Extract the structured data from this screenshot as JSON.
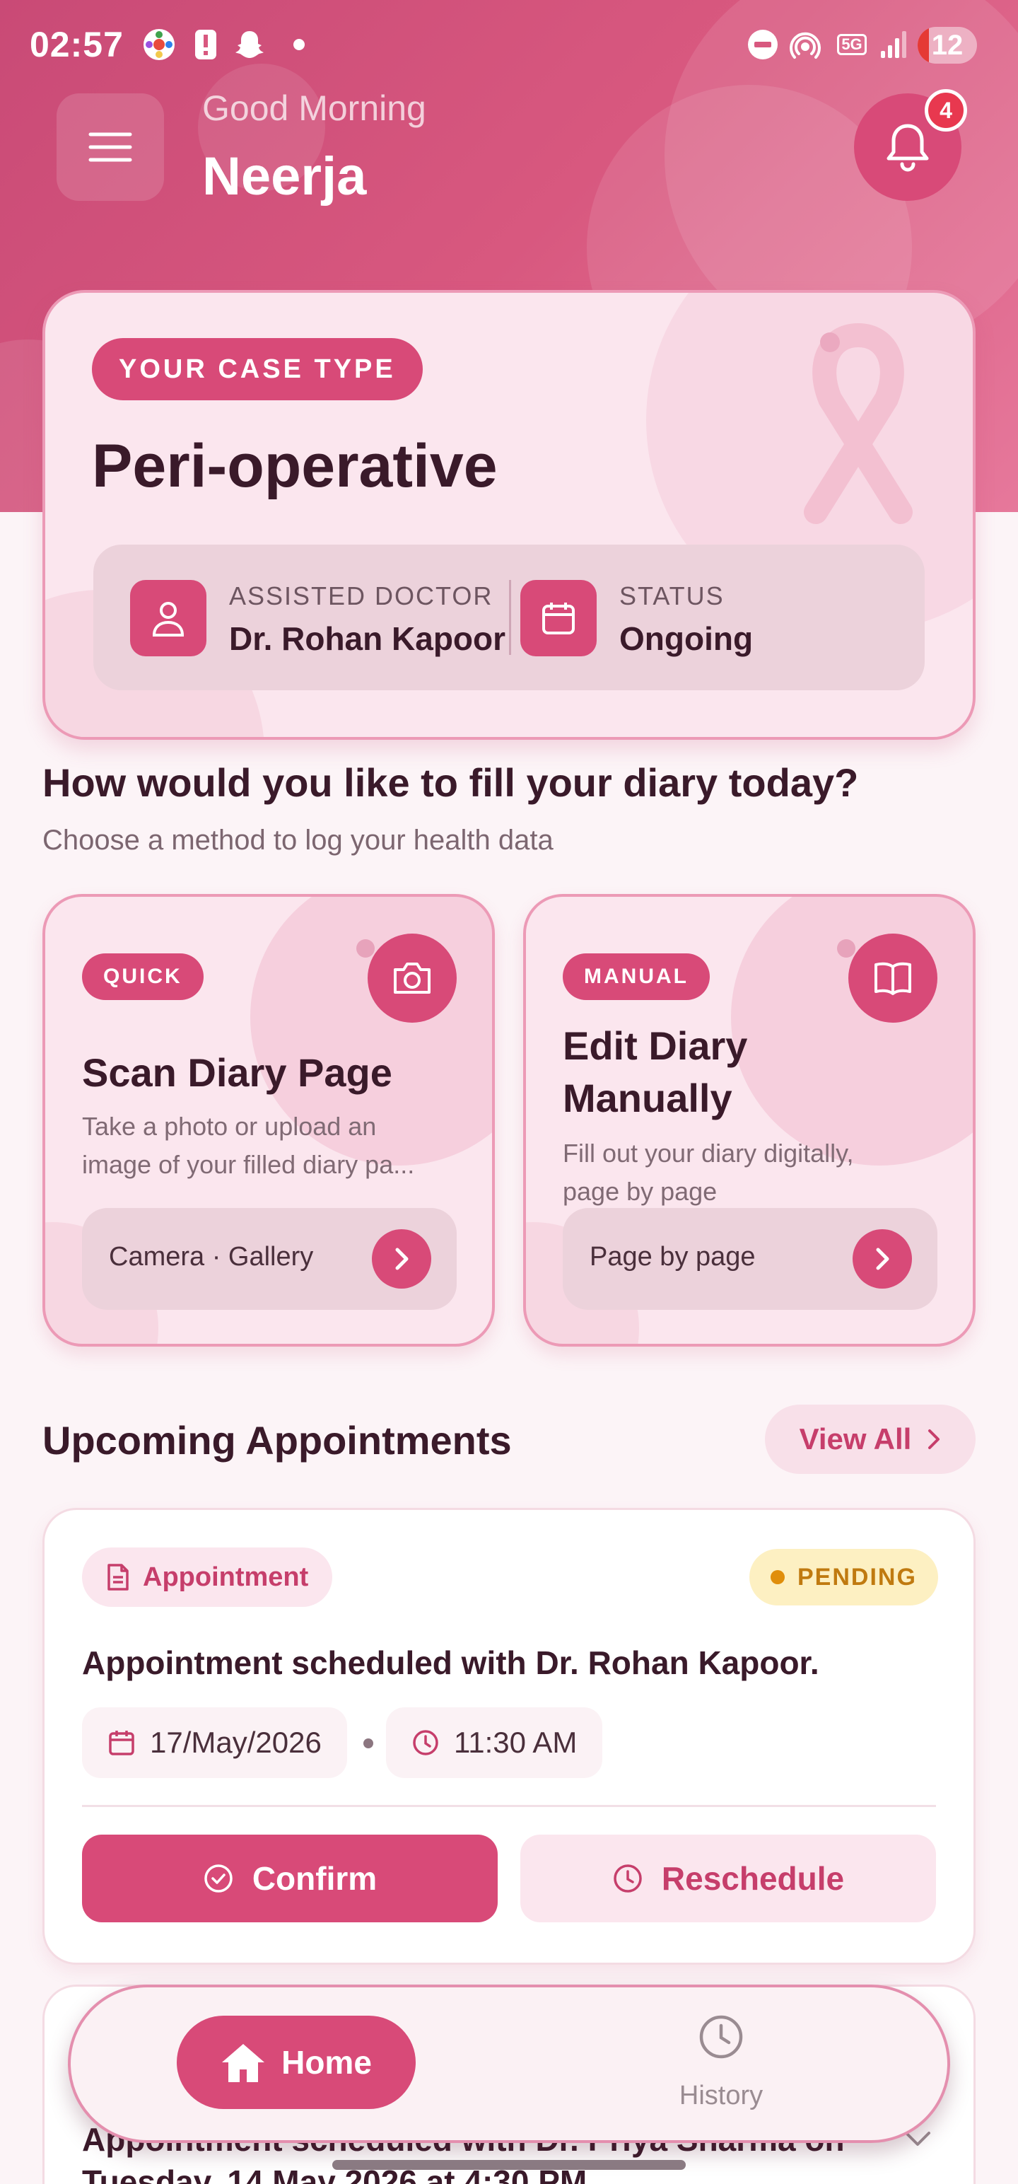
{
  "status_bar": {
    "time": "02:57",
    "network": "5G",
    "battery": "12"
  },
  "header": {
    "greeting": "Good Morning",
    "user_name": "Neerja",
    "notification_count": "4"
  },
  "case_card": {
    "label": "YOUR CASE TYPE",
    "case_type": "Peri-operative",
    "doctor_label": "ASSISTED DOCTOR",
    "doctor_name": "Dr. Rohan Kapoor",
    "status_label": "STATUS",
    "status_value": "Ongoing"
  },
  "diary": {
    "title": "How would you like to fill your diary today?",
    "subtitle": "Choose a method to log your health data",
    "methods": [
      {
        "tag": "QUICK",
        "title": "Scan Diary Page",
        "description_line1": "Take a photo or upload an",
        "description_line2": "image of your filled diary pa...",
        "action": "Camera · Gallery",
        "icon": "camera-icon"
      },
      {
        "tag": "MANUAL",
        "title_line1": "Edit Diary",
        "title_line2": "Manually",
        "description_line1": "Fill out your diary digitally,",
        "description_line2": "page by page",
        "action": "Page by page",
        "icon": "book-icon"
      }
    ]
  },
  "appointments": {
    "title": "Upcoming Appointments",
    "view_all": "View All",
    "items": [
      {
        "tag": "Appointment",
        "status": "PENDING",
        "text": "Appointment scheduled with Dr. Rohan Kapoor.",
        "date": "17/May/2026",
        "time": "11:30 AM",
        "confirm": "Confirm",
        "reschedule": "Reschedule"
      },
      {
        "text_line1": "Appointment scheduled with Dr. Priya Sharma on",
        "text_line2": "Tuesday, 14 May 2026 at 4:30 PM"
      }
    ]
  },
  "bottom_nav": {
    "home": "Home",
    "history": "History"
  },
  "colors": {
    "primary": "#d84a78",
    "header_gradient_start": "#c94a76",
    "header_gradient_end": "#e6789b",
    "card_bg": "#fbe6ee",
    "pending_bg": "#fdf0c2",
    "pending_text": "#c07a10"
  }
}
